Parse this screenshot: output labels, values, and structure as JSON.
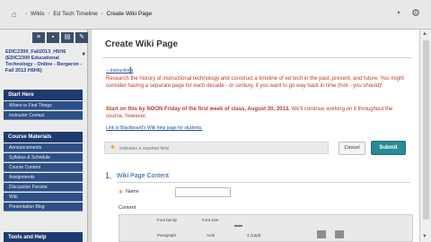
{
  "breadcrumb": {
    "items": [
      "Wikis",
      "Ed Tech Timeline",
      "Create Wiki Page"
    ],
    "separator": "›"
  },
  "course": {
    "title": "EDIC2300_Fall2013_H5H6 (EDIC2300 Educational Technology - Online - Bergeron - Fall 2013 H5H6)"
  },
  "sidebar": {
    "sections": [
      {
        "header": "Start Here",
        "items": [
          "Where to Find Things",
          "Instructor Contact"
        ]
      },
      {
        "header": "Course Materials",
        "items": [
          "Announcements",
          "Syllabus & Schedule",
          "Course Content",
          "Assignments",
          "Discussion Forums",
          "Wiki",
          "Presentation Blog"
        ]
      },
      {
        "header": "Tools and Help",
        "items": []
      }
    ]
  },
  "main": {
    "title": "Create Wiki Page",
    "instructions_link": "-- Instructions",
    "instructions_text": "Research the history of instructional technology and construct a timeline of ed tech in the past, present, and future. You might consider having a separate page for each decade - or century, if you want to go way back in time (hint - you should)!",
    "start_bold": "Start on this by NOON Friday of the first week of class, August 30, 2013.",
    "start_rest": "We'll continue working on it throughout the course, however.",
    "help_link": "Link to Blackboard's Wiki help page for students.",
    "required_note": "Indicates a required field.",
    "cancel_label": "Cancel",
    "submit_label": "Submit",
    "section_number": "1.",
    "section_title": "Wiki Page Content",
    "name_label": "Name",
    "name_value": "",
    "content_label": "Content",
    "editor": {
      "font_family": "Font family",
      "font_size": "Font size",
      "paragraph": "Paragraph",
      "arial": "Arial",
      "size_value": "3 (12pt)"
    }
  },
  "colors": {
    "accent": "#2a8a97",
    "menu_header": "#1f3a6e",
    "menu_item": "#2d4f86",
    "instruction_red": "#c0392b",
    "link_blue": "#1d4ea3"
  },
  "icons": [
    "home-icon",
    "sidebar-toggle-icon",
    "folder-icon",
    "grid-icon",
    "edit-icon",
    "course-menu-icon",
    "scroll-up-icon",
    "scroll-down-icon"
  ]
}
